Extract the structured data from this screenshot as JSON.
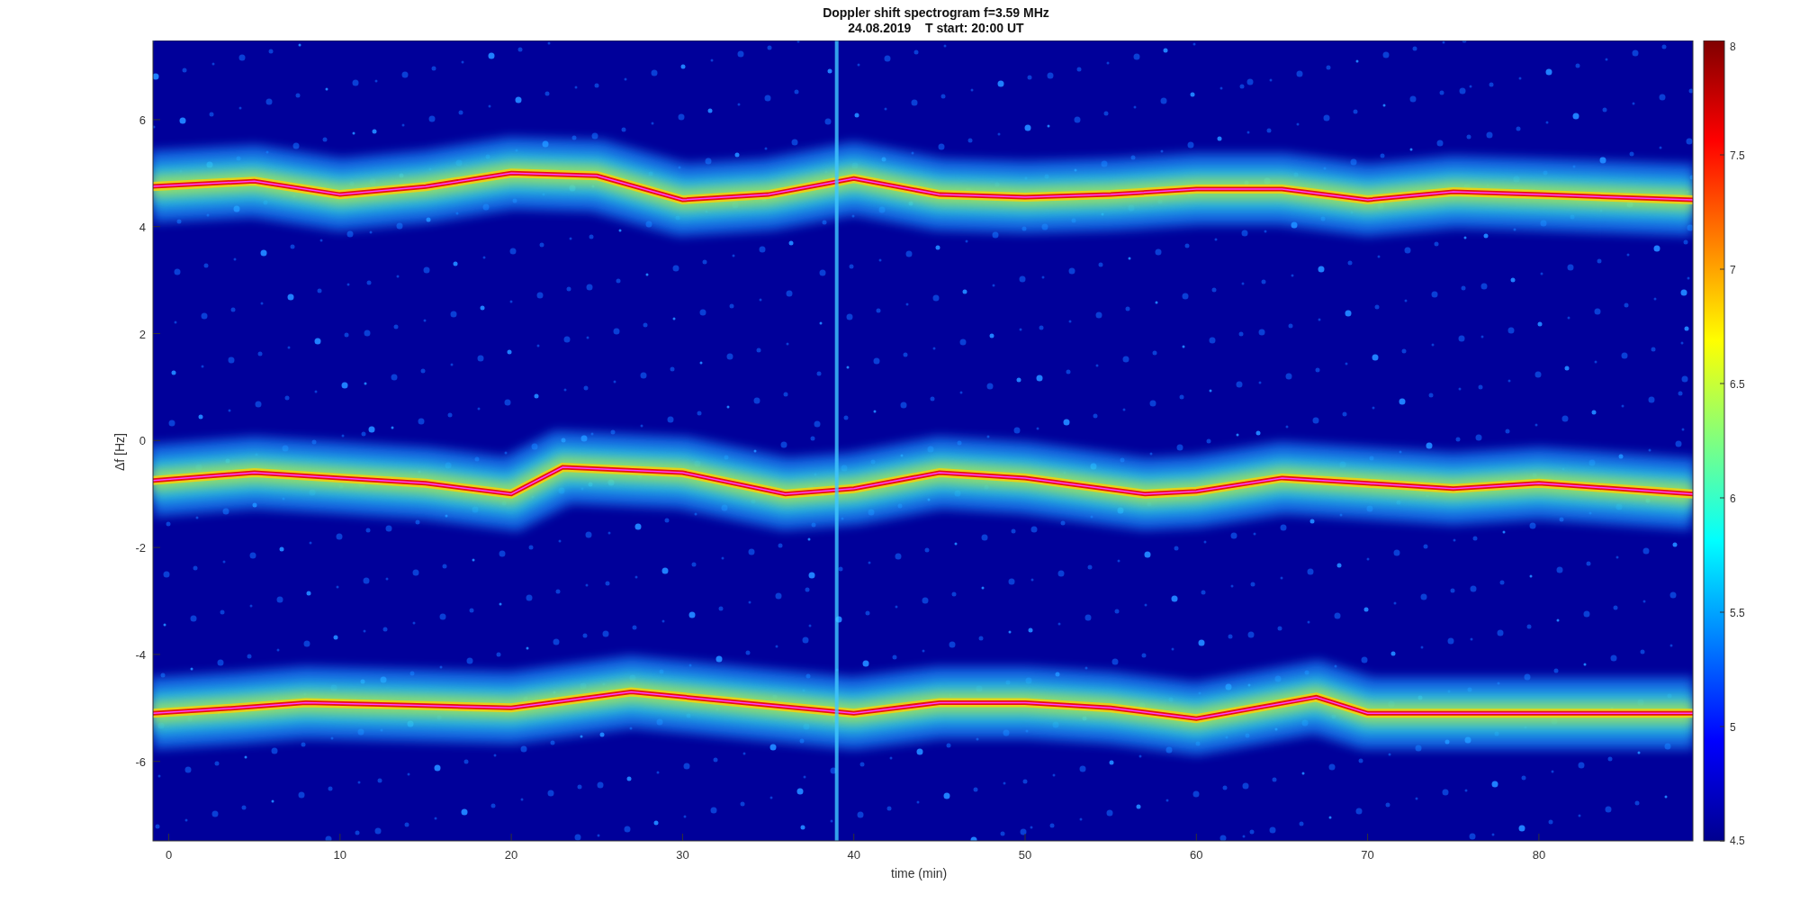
{
  "title": {
    "line_1": "Doppler shift spectrogram f=3.59 MHz",
    "line_2": "24.08.2019    T start: 20:00 UT"
  },
  "x_axis": {
    "label": "time (min)",
    "ticks": [
      "0",
      "10",
      "20",
      "30",
      "40",
      "50",
      "60",
      "70",
      "80"
    ]
  },
  "y_axis": {
    "label": "Δf [Hz]",
    "ticks": [
      "6",
      "4",
      "2",
      "0",
      "-2",
      "-4",
      "-6"
    ]
  },
  "colorbar": {
    "ticks": [
      "8",
      "7.5",
      "7",
      "6.5",
      "6",
      "5.5",
      "5",
      "4.5"
    ]
  }
}
